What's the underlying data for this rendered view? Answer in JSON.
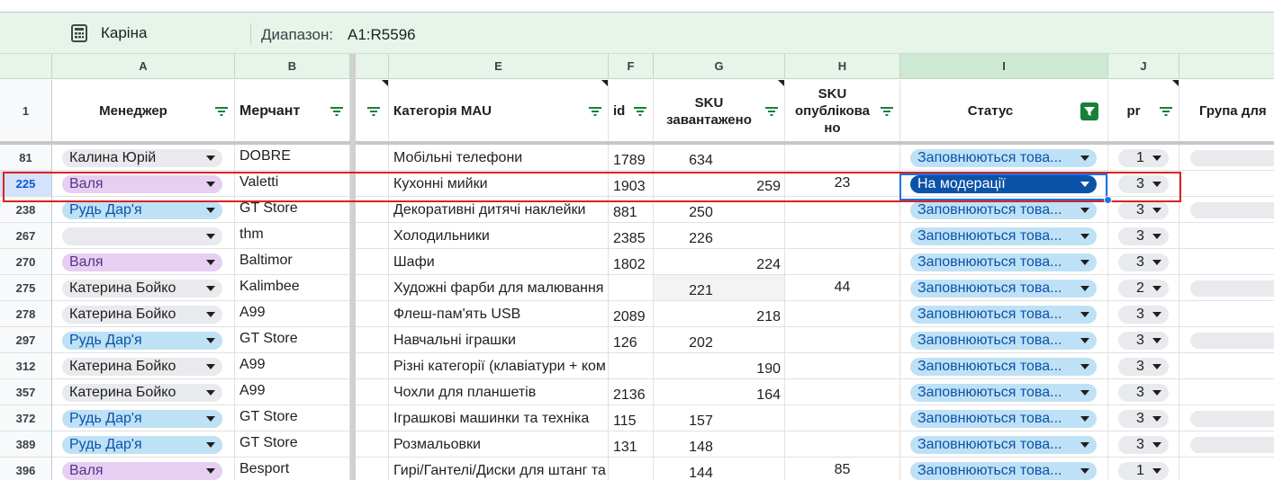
{
  "filter_bar": {
    "view_name": "Каріна",
    "range_label": "Диапазон:",
    "range_value": "A1:R5596"
  },
  "columns": [
    "A",
    "B",
    "E",
    "F",
    "G",
    "H",
    "I",
    "J",
    ""
  ],
  "headers": {
    "row_number": "1",
    "manager": "Менеджер",
    "merchant": "Мерчант",
    "category": "Категорія MAU",
    "id": "id",
    "sku_loaded_1": "SKU",
    "sku_loaded_2": "завантажено",
    "sku_published_1": "SKU",
    "sku_published_2": "опублікова",
    "sku_published_3": "но",
    "status": "Статус",
    "pr": "pr",
    "group": "Група для"
  },
  "rows": [
    {
      "num": "81",
      "manager": "Калина Юрій",
      "mgr_color": "gray",
      "merchant": "DOBRE",
      "category": "Мобільні телефони",
      "id": "1789",
      "sku_loaded": "634",
      "sku_published": "",
      "status": "Заповнюються това...",
      "pr": "1",
      "group_chip": true
    },
    {
      "num": "225",
      "manager": "Валя",
      "mgr_color": "purple",
      "merchant": "Valetti",
      "category": "Кухонні мийки",
      "id": "1903",
      "sku_loaded": "259",
      "sku_published": "23",
      "status": "На модерації",
      "pr": "3",
      "group_chip": false
    },
    {
      "num": "238",
      "manager": "Рудь Дар'я",
      "mgr_color": "blue",
      "merchant": "GT Store",
      "category": "Декоративні дитячі наклейки",
      "id": "881",
      "sku_loaded": "250",
      "sku_published": "",
      "status": "Заповнюються това...",
      "pr": "3",
      "group_chip": true
    },
    {
      "num": "267",
      "manager": "",
      "mgr_color": "gray",
      "merchant": "thm",
      "category": "Холодильники",
      "id": "2385",
      "sku_loaded": "226",
      "sku_published": "",
      "status": "Заповнюються това...",
      "pr": "3",
      "group_chip": false
    },
    {
      "num": "270",
      "manager": "Валя",
      "mgr_color": "purple",
      "merchant": "Baltimor",
      "category": "Шафи",
      "id": "1802",
      "sku_loaded": "224",
      "sku_published": "",
      "status": "Заповнюються това...",
      "pr": "3",
      "group_chip": false
    },
    {
      "num": "275",
      "manager": "Катерина Бойко",
      "mgr_color": "gray",
      "merchant": "Kalimbee",
      "category": "Художні фарби для малювання",
      "id": "",
      "sku_loaded": "221",
      "sku_published": "44",
      "status": "Заповнюються това...",
      "pr": "2",
      "group_chip": true
    },
    {
      "num": "278",
      "manager": "Катерина Бойко",
      "mgr_color": "gray",
      "merchant": "A99",
      "category": "Флеш-пам'ять USB",
      "id": "2089",
      "sku_loaded": "218",
      "sku_published": "",
      "status": "Заповнюються това...",
      "pr": "3",
      "group_chip": false
    },
    {
      "num": "297",
      "manager": "Рудь Дар'я",
      "mgr_color": "blue",
      "merchant": "GT Store",
      "category": "Навчальні іграшки",
      "id": "126",
      "sku_loaded": "202",
      "sku_published": "",
      "status": "Заповнюються това...",
      "pr": "3",
      "group_chip": true
    },
    {
      "num": "312",
      "manager": "Катерина Бойко",
      "mgr_color": "gray",
      "merchant": "A99",
      "category": "Різні категорії (клавіатури + ком",
      "id": "",
      "sku_loaded": "190",
      "sku_published": "",
      "status": "Заповнюються това...",
      "pr": "3",
      "group_chip": false
    },
    {
      "num": "357",
      "manager": "Катерина Бойко",
      "mgr_color": "gray",
      "merchant": "A99",
      "category": "Чохли для планшетів",
      "id": "2136",
      "sku_loaded": "164",
      "sku_published": "",
      "status": "Заповнюються това...",
      "pr": "3",
      "group_chip": false
    },
    {
      "num": "372",
      "manager": "Рудь Дар'я",
      "mgr_color": "blue",
      "merchant": "GT Store",
      "category": "Іграшкові машинки та техніка",
      "id": "115",
      "sku_loaded": "157",
      "sku_published": "",
      "status": "Заповнюються това...",
      "pr": "3",
      "group_chip": true
    },
    {
      "num": "389",
      "manager": "Рудь Дар'я",
      "mgr_color": "blue",
      "merchant": "GT Store",
      "category": "Розмальовки",
      "id": "131",
      "sku_loaded": "148",
      "sku_published": "",
      "status": "Заповнюються това...",
      "pr": "3",
      "group_chip": true
    },
    {
      "num": "396",
      "manager": "Валя",
      "mgr_color": "purple",
      "merchant": "Besport",
      "category": "Гирі/Гантелі/Диски для штанг та",
      "id": "",
      "sku_loaded": "144",
      "sku_published": "85",
      "status": "Заповнюються това...",
      "pr": "1",
      "group_chip": false
    }
  ],
  "colors": {
    "filter_bar_bg": "#e6f4ea",
    "selection": "#1a73e8",
    "highlight_outline": "#d9231f",
    "status_chip": "#bfe1f6",
    "status_chip_selected": "#0a53a8",
    "active_filter": "#188038"
  }
}
